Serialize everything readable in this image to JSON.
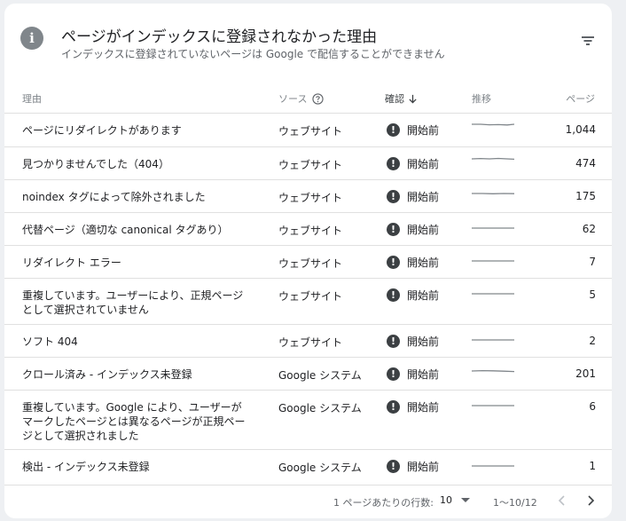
{
  "header": {
    "info_icon_glyph": "i",
    "title": "ページがインデックスに登録されなかった理由",
    "subtitle": "インデックスに登録されていないページは Google で配信することができません",
    "filter_icon": "filter-icon"
  },
  "columns": {
    "reason": "理由",
    "source": "ソース",
    "validation": "確認",
    "trend": "推移",
    "pages": "ページ"
  },
  "rows": [
    {
      "reason": "ページにリダイレクトがあります",
      "source": "ウェブサイト",
      "validation": "開始前",
      "pages": "1,044"
    },
    {
      "reason": "見つかりませんでした（404）",
      "source": "ウェブサイト",
      "validation": "開始前",
      "pages": "474"
    },
    {
      "reason": "noindex タグによって除外されました",
      "source": "ウェブサイト",
      "validation": "開始前",
      "pages": "175"
    },
    {
      "reason": "代替ページ（適切な canonical タグあり）",
      "source": "ウェブサイト",
      "validation": "開始前",
      "pages": "62"
    },
    {
      "reason": "リダイレクト エラー",
      "source": "ウェブサイト",
      "validation": "開始前",
      "pages": "7"
    },
    {
      "reason": "重複しています。ユーザーにより、正規ページとして選択されていません",
      "source": "ウェブサイト",
      "validation": "開始前",
      "pages": "5"
    },
    {
      "reason": "ソフト 404",
      "source": "ウェブサイト",
      "validation": "開始前",
      "pages": "2"
    },
    {
      "reason": "クロール済み - インデックス未登録",
      "source": "Google システム",
      "validation": "開始前",
      "pages": "201"
    },
    {
      "reason": "重複しています。Google により、ユーザーがマークしたページとは異なるページが正規ページとして選択されました",
      "source": "Google システム",
      "validation": "開始前",
      "pages": "6"
    },
    {
      "reason": "検出 - インデックス未登録",
      "source": "Google システム",
      "validation": "開始前",
      "pages": "1"
    }
  ],
  "footer": {
    "rows_per_page_label": "1 ページあたりの行数:",
    "rows_per_page_value": "10",
    "range": "1〜10/12"
  },
  "colors": {
    "status_alert": "#3c4043",
    "text_secondary": "#5f6368",
    "divider": "#e0e0e0"
  }
}
